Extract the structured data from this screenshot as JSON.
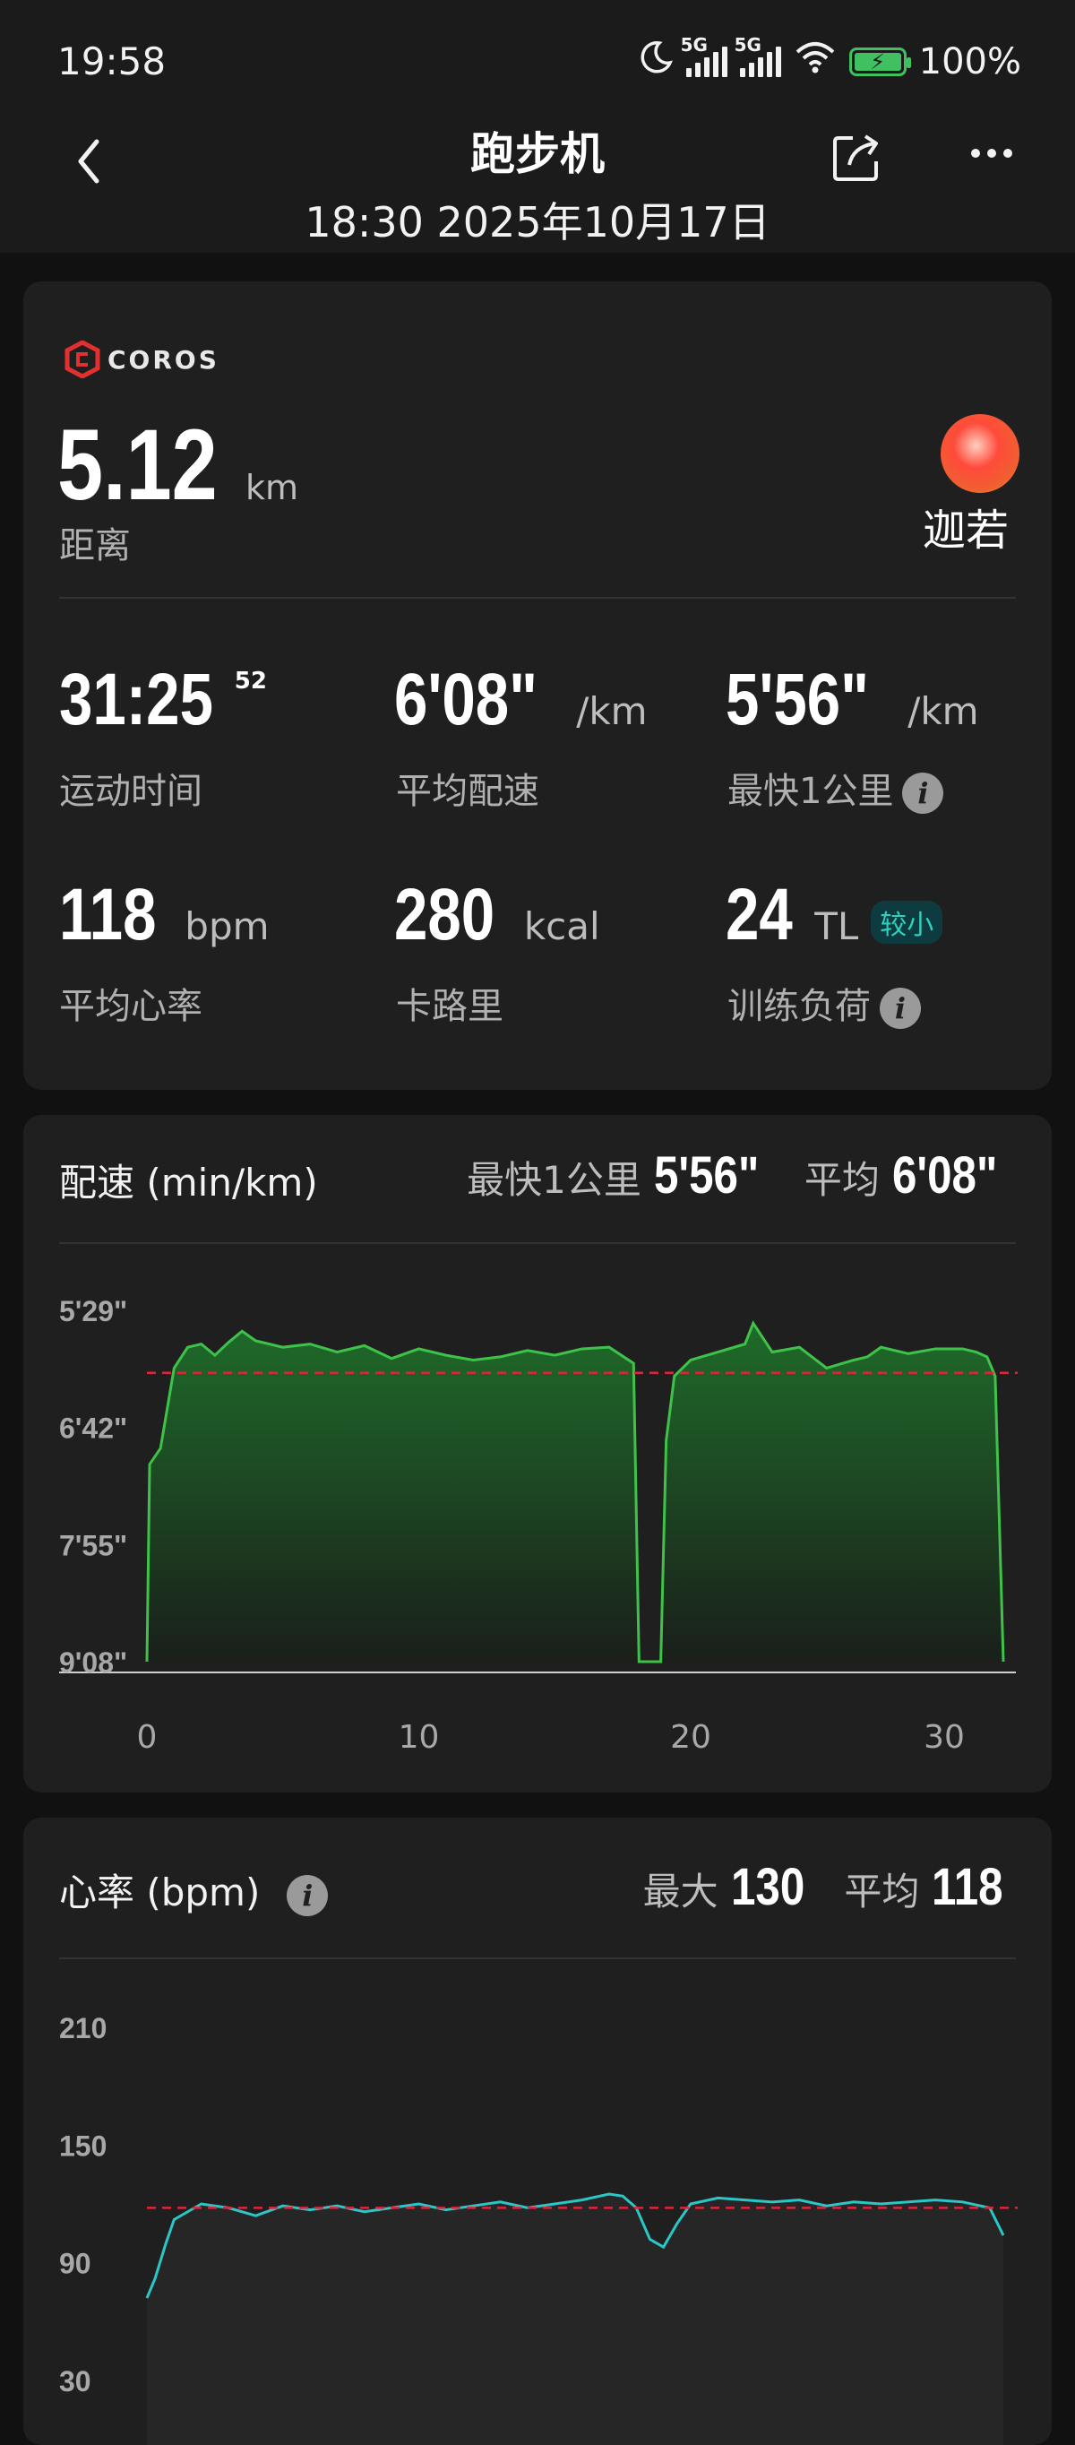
{
  "status_bar": {
    "time": "19:58",
    "network_1": "5G",
    "network_2": "5G",
    "battery": "100%",
    "icons": [
      "moon-icon",
      "signal-icon",
      "signal-icon",
      "wifi-icon",
      "battery-charging-icon"
    ]
  },
  "header": {
    "title": "跑步机",
    "subtitle": "18:30 2025年10月17日",
    "icons": [
      "back-icon",
      "share-icon",
      "more-icon"
    ]
  },
  "summary": {
    "brand": "COROS",
    "distance": {
      "value": "5.12",
      "unit": "km",
      "label": "距离"
    },
    "user": {
      "name": "迦若"
    },
    "metrics": {
      "time": {
        "value": "31:25",
        "sup": "52",
        "label": "运动时间"
      },
      "avg_pace": {
        "value": "6'08\"",
        "unit": "/km",
        "label": "平均配速"
      },
      "fastest_km": {
        "value": "5'56\"",
        "unit": "/km",
        "label": "最快1公里"
      },
      "avg_hr": {
        "value": "118",
        "unit": "bpm",
        "label": "平均心率"
      },
      "calories": {
        "value": "280",
        "unit": "kcal",
        "label": "卡路里"
      },
      "load": {
        "value": "24",
        "unit": "TL",
        "badge": "较小",
        "label": "训练负荷"
      }
    }
  },
  "pace_card": {
    "title": "配速 (min/km)",
    "fastest_label": "最快1公里",
    "fastest_value": "5'56\"",
    "avg_label": "平均",
    "avg_value": "6'08\""
  },
  "hr_card": {
    "title": "心率 (bpm)",
    "max_label": "最大",
    "max_value": "130",
    "avg_label": "平均",
    "avg_value": "118"
  },
  "chart_data": [
    {
      "type": "area",
      "title": "配速 (min/km)",
      "xlabel": "",
      "ylabel": "",
      "y_tick_labels": [
        "5'29\"",
        "6'42\"",
        "7'55\"",
        "9'08\""
      ],
      "x_tick_labels": [
        "0",
        "10",
        "20",
        "30"
      ],
      "y_axis_inverted": true,
      "ylim_seconds": [
        329,
        548
      ],
      "average_line_seconds": 368,
      "series_color": "#3fc24a",
      "average_line_color": "#e0243a",
      "x": [
        0,
        0.1,
        0.5,
        1,
        1.5,
        2,
        2.5,
        3,
        3.5,
        4,
        5,
        6,
        7,
        8,
        9,
        10,
        11,
        12,
        13,
        14,
        15,
        16,
        17,
        17.9,
        18.1,
        18.5,
        18.9,
        19.1,
        19.4,
        20,
        21,
        22,
        22.3,
        23,
        24,
        25,
        26,
        26.5,
        27,
        28,
        29,
        30,
        30.5,
        30.9,
        31.2,
        31.5
      ],
      "y": [
        548,
        425,
        415,
        365,
        352,
        350,
        357,
        349,
        342,
        348,
        352,
        350,
        355,
        351,
        359,
        353,
        357,
        360,
        358,
        354,
        357,
        353,
        352,
        362,
        548,
        548,
        548,
        410,
        370,
        360,
        355,
        350,
        337,
        355,
        352,
        365,
        360,
        358,
        352,
        356,
        353,
        353,
        355,
        358,
        370,
        548
      ]
    },
    {
      "type": "area",
      "title": "心率 (bpm)",
      "xlabel": "",
      "ylabel": "",
      "y_tick_labels": [
        "210",
        "150",
        "90",
        "30"
      ],
      "ylim": [
        30,
        210
      ],
      "average_line": 118,
      "series_color": "#2cc6c6",
      "average_line_color": "#e0243a",
      "x": [
        0,
        0.3,
        0.7,
        1,
        1.5,
        2,
        3,
        4,
        5,
        6,
        7,
        8,
        9,
        10,
        11,
        12,
        13,
        14,
        15,
        16,
        17,
        17.5,
        18,
        18.5,
        19,
        19.5,
        20,
        21,
        22,
        23,
        24,
        25,
        26,
        27,
        28,
        29,
        30,
        31,
        31.5
      ],
      "y": [
        72,
        82,
        100,
        112,
        116,
        120,
        118,
        114,
        119,
        117,
        119,
        116,
        118,
        120,
        117,
        119,
        121,
        118,
        120,
        122,
        125,
        124,
        118,
        102,
        98,
        110,
        120,
        123,
        122,
        121,
        122,
        119,
        121,
        120,
        121,
        122,
        121,
        118,
        104
      ]
    }
  ]
}
